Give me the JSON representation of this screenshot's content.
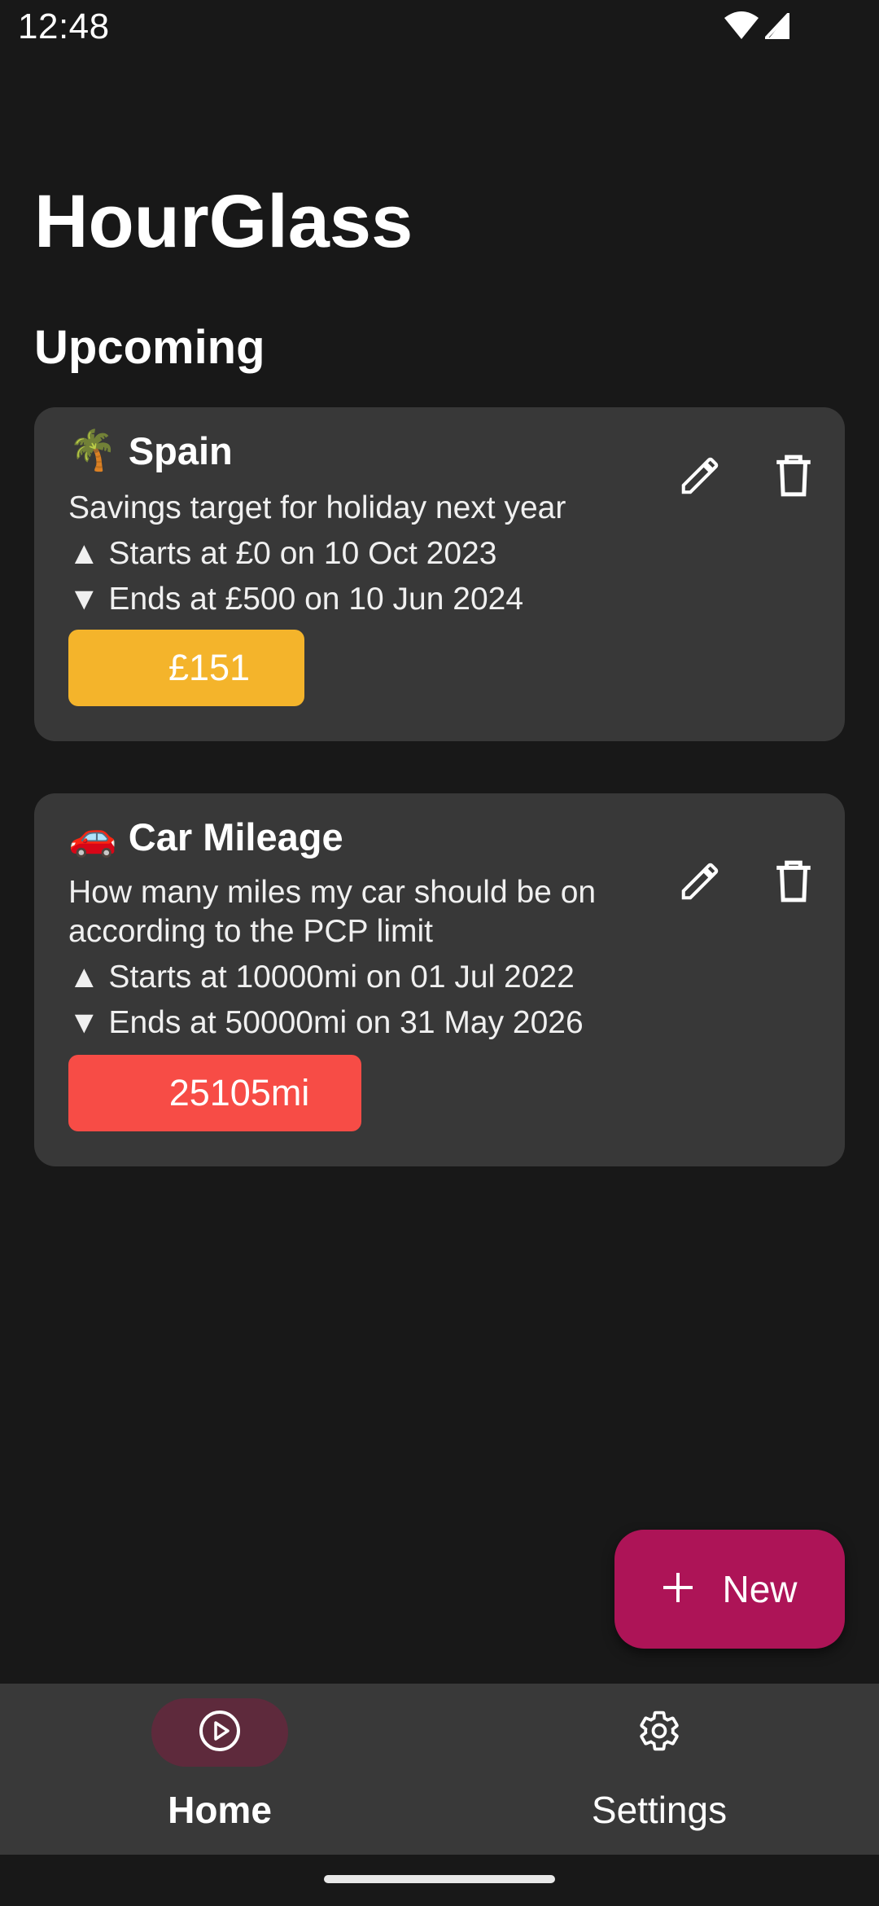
{
  "status_bar": {
    "time": "12:48",
    "icons": [
      "wifi-icon",
      "cell-signal-icon"
    ]
  },
  "app": {
    "title": "HourGlass"
  },
  "section": {
    "title": "Upcoming"
  },
  "cards": [
    {
      "emoji": "🌴",
      "title": "Spain",
      "description": "Savings target for holiday next year",
      "starts": "▲ Starts at £0 on 10 Oct 2023",
      "ends": "▼ Ends at £500 on 10 Jun 2024",
      "current_value": "£151",
      "badge_color": "#f4b42b",
      "icons": [
        "edit-icon",
        "delete-icon"
      ]
    },
    {
      "emoji": "🚗",
      "title": "Car Mileage",
      "description": "How many miles my car should be on according to the PCP limit",
      "starts": "▲ Starts at 10000mi on 01 Jul 2022",
      "ends": "▼ Ends at 50000mi on 31 May 2026",
      "current_value": "25105mi",
      "badge_color": "#f74c46",
      "icons": [
        "edit-icon",
        "delete-icon"
      ]
    }
  ],
  "fab": {
    "label": "New",
    "icon": "plus-icon",
    "color": "#ad1457"
  },
  "bottom_nav": {
    "items": [
      {
        "label": "Home",
        "icon": "play-circle-icon",
        "active": true
      },
      {
        "label": "Settings",
        "icon": "gear-icon",
        "active": false
      }
    ]
  },
  "colors": {
    "background": "#181818",
    "card": "#383838",
    "nav": "#393939",
    "nav_active_pill": "#5e2a3c"
  }
}
